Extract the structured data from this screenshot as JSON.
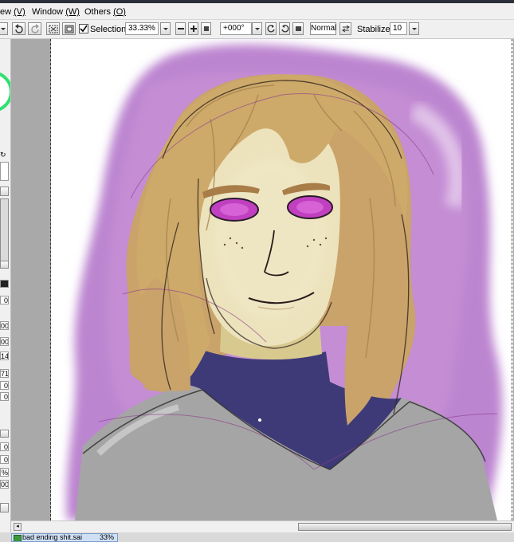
{
  "menubar": {
    "items": [
      {
        "label": "ew",
        "key": "(V)"
      },
      {
        "label": "Window",
        "key": "(W)"
      },
      {
        "label": "Others",
        "key": "(O)"
      }
    ]
  },
  "toolbar": {
    "selection_label": "Selection",
    "selection_checked": true,
    "zoom_value": "33.33%",
    "rotation_value": "+000°",
    "blend_mode": "Normal",
    "stabilizer_label": "Stabilizer",
    "stabilizer_value": "10"
  },
  "left_panel": {
    "values": [
      "0",
      "00",
      "00",
      "14",
      "71",
      "0",
      "0",
      "0",
      "0",
      "%",
      "00"
    ]
  },
  "document_tab": {
    "name": "bad ending shit.sai",
    "zoom": "33%"
  },
  "colors": {
    "ui_bg": "#f0f0f0",
    "canvas_bg": "#a9a9a9",
    "paper": "#ffffff",
    "accent_purple": "#b070c8",
    "hair": "#cdaa6a",
    "skin": "#ece3bd",
    "eyes": "#c040c0",
    "turtleneck": "#3e3a78",
    "shirt": "#a3a3a3",
    "selected_tab": "#cfe0f5"
  },
  "icons": [
    "undo-icon",
    "redo-icon",
    "select-all-icon",
    "deselect-icon",
    "zoom-out-icon",
    "zoom-in-icon",
    "zoom-reset-icon",
    "rotate-left-icon",
    "rotate-right-icon",
    "rotate-reset-icon",
    "flip-icon",
    "dropdown-arrow-icon",
    "document-icon"
  ]
}
